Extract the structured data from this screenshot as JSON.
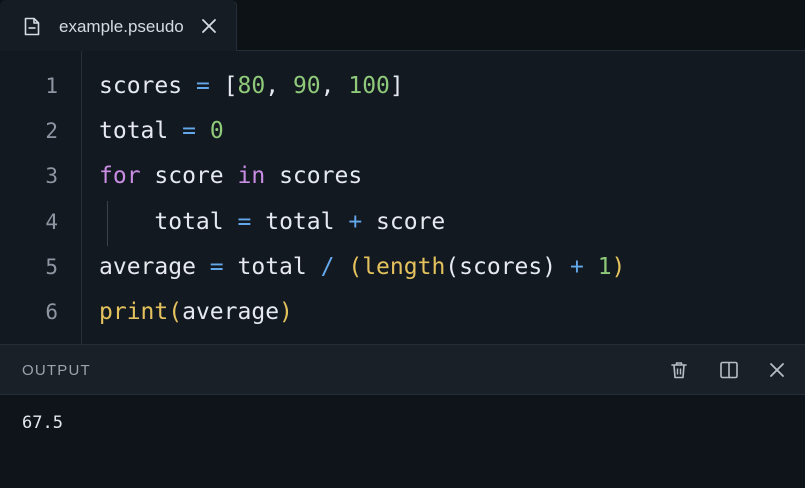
{
  "tab": {
    "filename": "example.pseudo",
    "file_icon": "file-icon",
    "close_icon": "close-icon"
  },
  "editor": {
    "lines": [
      {
        "number": "1",
        "tokens": [
          {
            "t": "scores",
            "k": "id"
          },
          {
            "t": " ",
            "k": "ws"
          },
          {
            "t": "=",
            "k": "op"
          },
          {
            "t": " ",
            "k": "ws"
          },
          {
            "t": "[",
            "k": "id"
          },
          {
            "t": "80",
            "k": "num"
          },
          {
            "t": ", ",
            "k": "id"
          },
          {
            "t": "90",
            "k": "num"
          },
          {
            "t": ", ",
            "k": "id"
          },
          {
            "t": "100",
            "k": "num"
          },
          {
            "t": "]",
            "k": "id"
          }
        ]
      },
      {
        "number": "2",
        "tokens": [
          {
            "t": "total",
            "k": "id"
          },
          {
            "t": " ",
            "k": "ws"
          },
          {
            "t": "=",
            "k": "op"
          },
          {
            "t": " ",
            "k": "ws"
          },
          {
            "t": "0",
            "k": "num"
          }
        ]
      },
      {
        "number": "3",
        "tokens": [
          {
            "t": "for",
            "k": "kw"
          },
          {
            "t": " ",
            "k": "ws"
          },
          {
            "t": "score",
            "k": "id"
          },
          {
            "t": " ",
            "k": "ws"
          },
          {
            "t": "in",
            "k": "kw"
          },
          {
            "t": " ",
            "k": "ws"
          },
          {
            "t": "scores",
            "k": "id"
          }
        ]
      },
      {
        "number": "4",
        "indent": "    ",
        "tokens": [
          {
            "t": "total",
            "k": "id"
          },
          {
            "t": " ",
            "k": "ws"
          },
          {
            "t": "=",
            "k": "op"
          },
          {
            "t": " ",
            "k": "ws"
          },
          {
            "t": "total",
            "k": "id"
          },
          {
            "t": " ",
            "k": "ws"
          },
          {
            "t": "+",
            "k": "op"
          },
          {
            "t": " ",
            "k": "ws"
          },
          {
            "t": "score",
            "k": "id"
          }
        ]
      },
      {
        "number": "5",
        "tokens": [
          {
            "t": "average",
            "k": "id"
          },
          {
            "t": " ",
            "k": "ws"
          },
          {
            "t": "=",
            "k": "op"
          },
          {
            "t": " ",
            "k": "ws"
          },
          {
            "t": "total",
            "k": "id"
          },
          {
            "t": " ",
            "k": "ws"
          },
          {
            "t": "/",
            "k": "op"
          },
          {
            "t": " ",
            "k": "ws"
          },
          {
            "t": "(",
            "k": "br"
          },
          {
            "t": "length",
            "k": "fn"
          },
          {
            "t": "(",
            "k": "id"
          },
          {
            "t": "scores",
            "k": "id"
          },
          {
            "t": ")",
            "k": "id"
          },
          {
            "t": " ",
            "k": "ws"
          },
          {
            "t": "+",
            "k": "op"
          },
          {
            "t": " ",
            "k": "ws"
          },
          {
            "t": "1",
            "k": "num"
          },
          {
            "t": ")",
            "k": "br"
          }
        ]
      },
      {
        "number": "6",
        "tokens": [
          {
            "t": "print",
            "k": "fn"
          },
          {
            "t": "(",
            "k": "br"
          },
          {
            "t": "average",
            "k": "id"
          },
          {
            "t": ")",
            "k": "br"
          }
        ]
      }
    ]
  },
  "output": {
    "title": "OUTPUT",
    "text": "67.5",
    "icons": [
      "trash-icon",
      "split-panel-icon",
      "close-icon"
    ]
  },
  "colors": {
    "background": "#131920",
    "keyword": "#c98de4",
    "operator": "#64a8ec",
    "number": "#8fc97a",
    "function": "#e4c25d"
  }
}
